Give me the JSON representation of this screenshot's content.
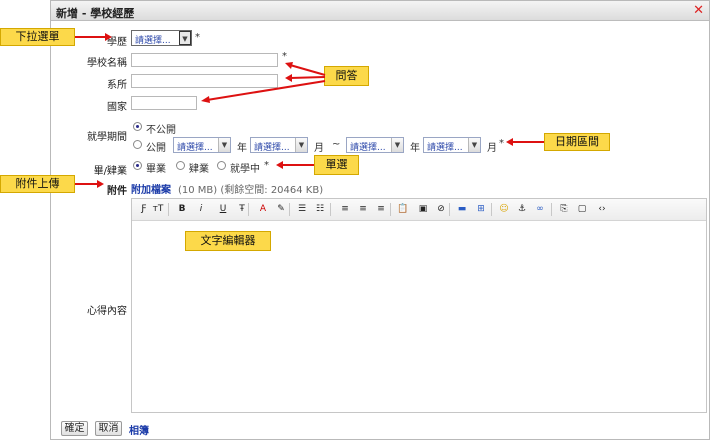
{
  "dialog": {
    "title": "新增 - 學校經歷",
    "close_icon": "✕"
  },
  "form": {
    "degree": {
      "label": "學歷",
      "value": "請選擇...",
      "required": "*"
    },
    "school": {
      "label": "學校名稱",
      "required": "*"
    },
    "department": {
      "label": "系所"
    },
    "country": {
      "label": "國家"
    },
    "period": {
      "label": "就學期間",
      "option_private": "不公開",
      "option_public": "公開",
      "start_year": "請選擇...",
      "year_unit": "年",
      "start_month": "請選擇...",
      "month_unit": "月",
      "tilde": "~",
      "end_year": "請選擇...",
      "end_month": "請選擇...",
      "required": "*"
    },
    "status": {
      "label": "畢/肄業",
      "options": [
        "畢業",
        "肄業",
        "就學中"
      ],
      "required": "*"
    },
    "attachment": {
      "label": "附件",
      "link": "附加檔案",
      "info": "(10 MB) (剩餘空間: 20464 KB)"
    },
    "content": {
      "label": "心得內容"
    }
  },
  "toolbar": {
    "icons": [
      "format-icon",
      "font-size-icon",
      "bold-icon",
      "italic-icon",
      "underline-icon",
      "strikethrough-icon",
      "text-color-icon",
      "highlight-icon",
      "ordered-list-icon",
      "unordered-list-icon",
      "align-left-icon",
      "align-center-icon",
      "align-right-icon",
      "paste-icon",
      "image-icon",
      "no-format-icon",
      "media-icon",
      "table-icon",
      "emoji-icon",
      "anchor-icon",
      "link-icon",
      "insert-file-icon",
      "fullscreen-icon",
      "source-icon"
    ],
    "glyphs": [
      "Ƒ",
      "тT",
      "B",
      "i",
      "U",
      "Ŧ",
      "A",
      "✎",
      "☰",
      "☷",
      "≡",
      "≡",
      "≡",
      "📋",
      "▣",
      "⊘",
      "▬",
      "⊞",
      "☺",
      "⚓",
      "∞",
      "⎘",
      "▢",
      "‹›"
    ]
  },
  "footer": {
    "confirm": "確定",
    "cancel": "取消",
    "album": "相簿"
  },
  "annotations": {
    "dropdown": "下拉選單",
    "qa": "問答",
    "date_range": "日期區間",
    "single_choice": "單選",
    "upload": "附件上傳",
    "editor": "文字編輯器"
  },
  "colors": {
    "annotation_bg": "#fcd94a",
    "arrow": "#dd1111",
    "link": "#1a3aa8"
  }
}
